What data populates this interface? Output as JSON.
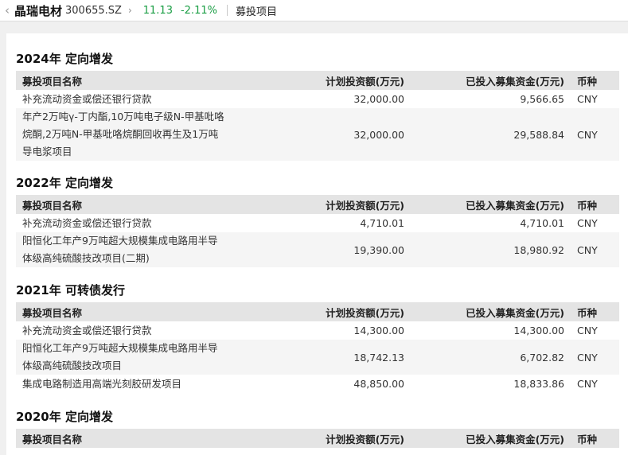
{
  "header": {
    "back_icon": "chevron-left-icon",
    "stock_name": "晶瑞电材",
    "stock_code": "300655.SZ",
    "dropdown_icon": "chevron-right-icon",
    "price": "11.13",
    "change_pct": "-2.11%",
    "page_title": "募投项目",
    "price_color": "#1a9e44"
  },
  "columns": {
    "name": "募投项目名称",
    "planned": "计划投资额(万元)",
    "invested": "已投入募集资金(万元)",
    "currency": "币种"
  },
  "sections": [
    {
      "title": "2024年 定向增发",
      "rows": [
        {
          "name_lines": [
            "补充流动资金或偿还银行贷款"
          ],
          "planned": "32,000.00",
          "invested": "9,566.65",
          "currency": "CNY"
        },
        {
          "name_lines": [
            "年产2万吨γ-丁内酯,10万吨电子级N-甲基吡咯",
            "烷酮,2万吨N-甲基吡咯烷酮回收再生及1万吨",
            "导电浆项目"
          ],
          "planned": "32,000.00",
          "invested": "29,588.84",
          "currency": "CNY"
        }
      ]
    },
    {
      "title": "2022年 定向增发",
      "rows": [
        {
          "name_lines": [
            "补充流动资金或偿还银行贷款"
          ],
          "planned": "4,710.01",
          "invested": "4,710.01",
          "currency": "CNY"
        },
        {
          "name_lines": [
            "阳恒化工年产9万吨超大规模集成电路用半导",
            "体级高纯硫酸技改项目(二期)"
          ],
          "planned": "19,390.00",
          "invested": "18,980.92",
          "currency": "CNY"
        }
      ]
    },
    {
      "title": "2021年 可转债发行",
      "rows": [
        {
          "name_lines": [
            "补充流动资金或偿还银行贷款"
          ],
          "planned": "14,300.00",
          "invested": "14,300.00",
          "currency": "CNY"
        },
        {
          "name_lines": [
            "阳恒化工年产9万吨超大规模集成电路用半导",
            "体级高纯硫酸技改项目"
          ],
          "planned": "18,742.13",
          "invested": "6,702.82",
          "currency": "CNY"
        },
        {
          "name_lines": [
            "集成电路制造用高端光刻胶研发项目"
          ],
          "planned": "48,850.00",
          "invested": "18,833.86",
          "currency": "CNY"
        }
      ]
    },
    {
      "title": "2020年 定向增发",
      "rows": []
    }
  ]
}
